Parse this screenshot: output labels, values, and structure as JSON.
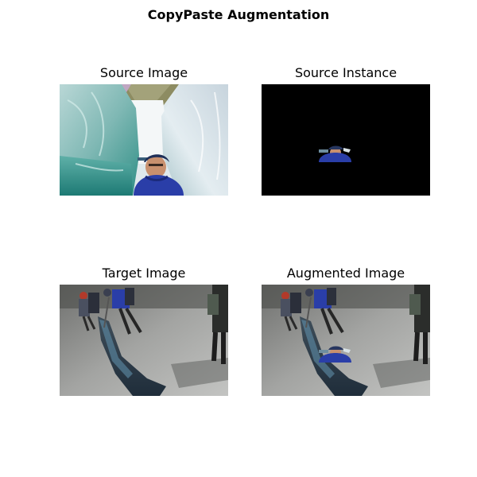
{
  "figure": {
    "title": "CopyPaste Augmentation"
  },
  "panels": [
    {
      "title": "Source Image"
    },
    {
      "title": "Source Instance"
    },
    {
      "title": "Target Image"
    },
    {
      "title": "Augmented Image"
    }
  ],
  "colors": {
    "background": "#ffffff",
    "mask_background": "#000000",
    "jacket_blue": "#2a3ea8",
    "ice_teal": "#3f9c95",
    "glacier_gray": "#8b8c8a"
  }
}
